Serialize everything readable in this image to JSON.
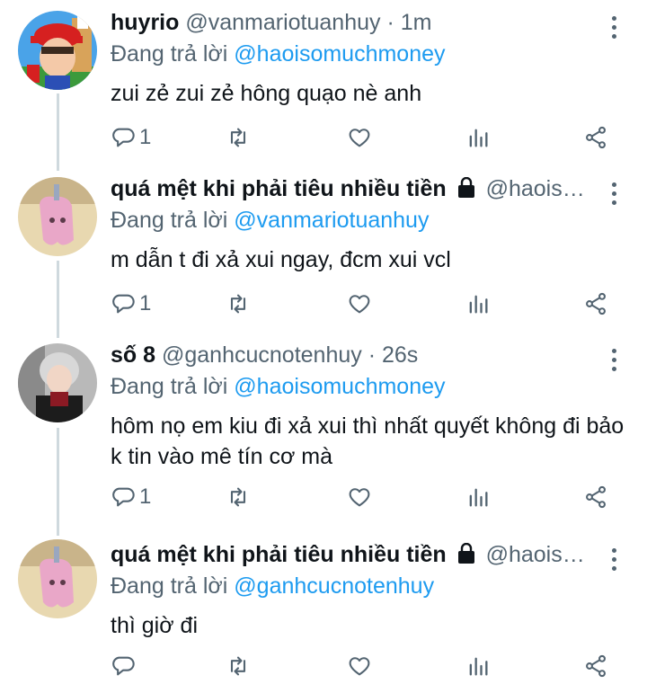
{
  "reply_prefix": "Đang trả lời",
  "colors": {
    "link": "#1d9bf0",
    "secondary": "#536471",
    "text": "#0f1419",
    "thread_line": "#cfd9de"
  },
  "tweets": [
    {
      "name": "huyrio",
      "handle": "@vanmariotuanhuy",
      "time": "1m",
      "reply_to": "@haoisomuchmoney",
      "text": "zui zẻ zui zẻ hông quạo nè anh",
      "reply_count": "1",
      "locked": false
    },
    {
      "name": "quá mệt khi phải tiêu nhiều tiền",
      "handle": "@haois…",
      "time": "",
      "reply_to": "@vanmariotuanhuy",
      "text": "m dẫn t đi xả xui ngay, đcm xui vcl",
      "reply_count": "1",
      "locked": true
    },
    {
      "name": "số 8",
      "handle": "@ganhcucnotenhuy",
      "time": "26s",
      "reply_to": "@haoisomuchmoney",
      "text": "hôm nọ em kiu đi xả xui thì nhất quyết không đi bảo k tin vào mê tín cơ mà",
      "reply_count": "1",
      "locked": false
    },
    {
      "name": "quá mệt khi phải tiêu nhiều tiền",
      "handle": "@haois…",
      "time": "",
      "reply_to": "@ganhcucnotenhuy",
      "text": "thì giờ đi",
      "reply_count": "",
      "locked": true
    }
  ]
}
